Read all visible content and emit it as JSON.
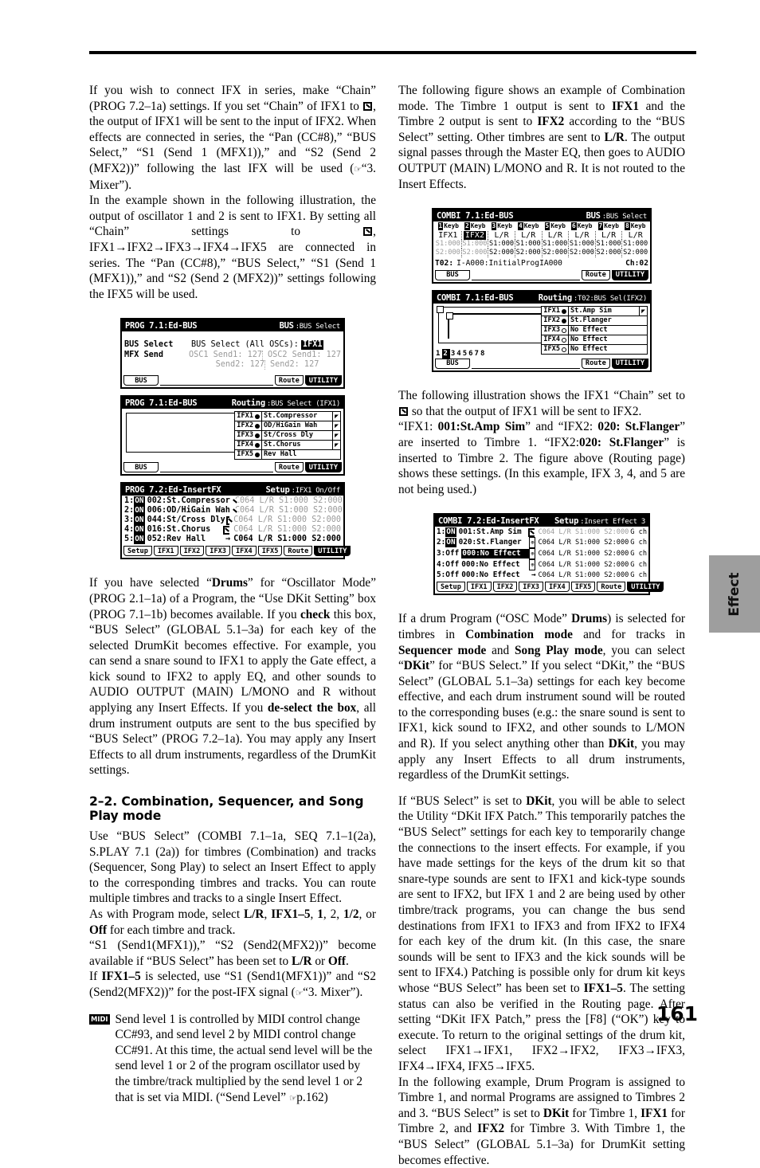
{
  "page": {
    "number": "161",
    "side_tab": "Effect"
  },
  "left_column": {
    "paragraphs": [
      "If you wish to connect IFX in series, make “Chain” (PROG 7.2–1a) settings. If you set “Chain” of IFX1 to ☑, the output of IFX1 will be sent to the input of IFX2. When effects are connected in series, the “Pan (CC#8),” “BUS Select,” “S1 (Send 1 (MFX1)),” and “S2 (Send 2 (MFX2))” following the last IFX will be used (☞“3. Mixer”).",
      "In the example shown in the following illustration, the output of oscillator 1 and 2 is sent to IFX1. By setting all “Chain” settings to ☑, IFX1→IFX2→IFX3→IFX4→IFX5 are connected in series. The “Pan (CC#8),” “BUS Select,” “S1 (Send 1 (MFX1)),” and “S2 (Send 2 (MFX2))” settings following the IFX5 will be used.",
      "If you have selected “Drums” for “Oscillator Mode” (PROG 2.1–1a) of a Program, the “Use DKit Setting” box (PROG 7.1–1b) becomes available. If you check this box, “BUS Select” (GLOBAL 5.1–3a) for each key of the selected DrumKit becomes effective. For example, you can send a snare sound to IFX1 to apply the Gate effect, a kick sound to IFX2 to apply EQ, and other sounds to AUDIO OUTPUT (MAIN) L/MONO and R without applying any Insert Effects. If you de-select the box, all drum instrument outputs are sent to the bus specified by “BUS Select” (PROG 7.2–1a). You may apply any Insert Effects to all drum instruments, regardless of the DrumKit settings."
    ],
    "heading": "2–2. Combination, Sequencer, and Song Play mode",
    "after_heading": [
      "Use “BUS Select” (COMBI 7.1–1a, SEQ 7.1–1(2a), S.PLAY 7.1 (2a)) for timbres (Combination) and tracks (Sequencer, Song Play) to select an Insert Effect to apply to the corresponding timbres and tracks. You can route multiple timbres and tracks to a single Insert Effect.",
      "As with Program mode, select L/R, IFX1–5, 1, 2, 1/2, or Off for each timbre and track.",
      "“S1 (Send1(MFX1)),” “S2 (Send2(MFX2))” become available if “BUS Select” has been set to L/R or Off.",
      "If IFX1–5 is selected, use “S1 (Send1(MFX1))” and “S2 (Send2(MFX2))” for the post-IFX signal (☞“3. Mixer”)."
    ],
    "midi_note": {
      "badge": "MIDI",
      "text": "Send level 1 is controlled by MIDI control change CC#93, and send level 2 by MIDI control change CC#91. At this time, the actual send level will be the send level 1 or 2 of the program oscillator used by the timbre/track multiplied by the send level 1 or 2 that is set via MIDI. (“Send Level” ☞p.162)"
    }
  },
  "right_column": {
    "paragraphs_top": [
      "The following figure shows an example of Combination mode. The Timbre 1 output is sent to IFX1 and the Timbre 2 output is sent to IFX2 according to the “BUS Select” setting. Other timbres are sent to L/R. The output signal passes through the Master EQ, then goes to AUDIO OUTPUT (MAIN) L/MONO and R. It is not routed to the Insert Effects."
    ],
    "paragraphs_mid": [
      "The following illustration shows the IFX1 “Chain” set to ☑ so that the output of IFX1 will be sent to IFX2.",
      "“IFX1: 001:St.Amp Sim” and “IFX2: 020: St.Flanger” are inserted to Timbre 1. “IFX2:020: St.Flanger” is inserted to Timbre 2. The figure above (Routing page) shows these settings. (In this example, IFX 3, 4, and 5 are not being used.)"
    ],
    "paragraphs_bottom": [
      "If a drum Program (“OSC Mode” Drums) is selected for timbres in Combination mode and for tracks in Sequencer mode and Song Play mode, you can select “DKit” for “BUS Select.” If you select “DKit,” the “BUS Select” (GLOBAL 5.1–3a) settings for each key become effective, and each drum instrument sound will be routed to the corresponding buses (e.g.: the snare sound is sent to IFX1, kick sound to IFX2, and other sounds to L/MON and R). If you select anything other than DKit, you may apply any Insert Effects to all drum instruments, regardless of the DrumKit settings.",
      "If “BUS Select” is set to DKit, you will be able to select the Utility “DKit IFX Patch.” This temporarily patches the “BUS Select” settings for each key to temporarily change the connections to the insert effects. For example, if you have made settings for the keys of the drum kit so that snare-type sounds are sent to IFX1 and kick-type sounds are sent to IFX2, but IFX 1 and 2 are being used by other timbre/track programs, you can change the bus send destinations from IFX1 to IFX3 and from IFX2 to IFX4 for each key of the drum kit. (In this case, the snare sounds will be sent to IFX3 and the kick sounds will be sent to IFX4.) Patching is possible only for drum kit keys whose “BUS Select” has been set to IFX1–5. The setting status can also be verified in the Routing page. After setting “DKit IFX Patch,” press the [F8] (“OK”) key to execute. To return to the original settings of the drum kit, select IFX1→IFX1, IFX2→IFX2, IFX3→IFX3, IFX4→IFX4, IFX5→IFX5.",
      "In the following example, Drum Program is assigned to Timbre 1, and normal Programs are assigned to Timbres 2 and 3. “BUS Select” is set to DKit for Timbre 1, IFX1 for Timbre 2, and IFX2 for Timbre 3. With Timbre 1, the “BUS Select” (GLOBAL 5.1–3a) for DrumKit setting becomes effective."
    ]
  },
  "lcd1": {
    "title_left": "PROG 7.1:Ed-BUS",
    "title_right_bold": "BUS",
    "title_right_small": ":BUS Select",
    "label1": "BUS Select",
    "label1_value_name": "BUS Select (All OSCs):",
    "label1_value": "IFX1",
    "label2": "MFX Send",
    "ghost_line1a": "OSC1 Send1: 127",
    "ghost_line1b": "OSC2 Send1: 127",
    "ghost_line2a": "Send2: 127",
    "ghost_line2b": "Send2: 127",
    "tab_left": "BUS",
    "tab_route": "Route",
    "tab_utility": "UTILITY"
  },
  "lcd2": {
    "title_left": "PROG 7.1:Ed-BUS",
    "title_right_bold": "Routing",
    "title_right_small": ":BUS Select (IFX1)",
    "fx_rows": [
      {
        "label": "IFX1",
        "state": "filled",
        "name": "St.Compressor",
        "chain": true
      },
      {
        "label": "IFX2",
        "state": "filled",
        "name": "OD/HiGain Wah",
        "chain": true
      },
      {
        "label": "IFX3",
        "state": "filled",
        "name": "St/Cross Dly",
        "chain": true
      },
      {
        "label": "IFX4",
        "state": "filled",
        "name": "St.Chorus",
        "chain": true
      },
      {
        "label": "IFX5",
        "state": "filled",
        "name": "Rev Hall",
        "chain": false
      }
    ],
    "tab_left": "BUS",
    "tab_route": "Route",
    "tab_utility": "UTILITY"
  },
  "lcd3": {
    "title_left": "PROG 7.2:Ed-InsertFX",
    "title_right_bold": "Setup",
    "title_right_small": ":IFX1 On/Off",
    "rows": [
      {
        "num": "1:",
        "on": "ON",
        "name": "002:St.Compressor",
        "chain": "chain",
        "tail": "C064 L/R S1:000 S2:000",
        "ghost": true
      },
      {
        "num": "2:",
        "on": "ON",
        "name": "006:OD/HiGain Wah",
        "chain": "chain",
        "tail": "C064 L/R S1:000 S2:000",
        "ghost": true
      },
      {
        "num": "3:",
        "on": "ON",
        "name": "044:St/Cross Dly",
        "chain": "chain",
        "tail": "C064 L/R S1:000 S2:000",
        "ghost": true
      },
      {
        "num": "4:",
        "on": "ON",
        "name": "016:St.Chorus",
        "chain": "chain",
        "tail": "C064 L/R S1:000 S2:000",
        "ghost": true
      },
      {
        "num": "5:",
        "on": "ON",
        "name": "052:Rev Hall",
        "chain": "arrow",
        "tail": "C064 L/R S1:000 S2:000",
        "ghost": false
      }
    ],
    "tabs": [
      "Setup",
      "IFX1",
      "IFX2",
      "IFX3",
      "IFX4",
      "IFX5",
      "Route",
      "UTILITY"
    ]
  },
  "lcd4": {
    "title_left": "COMBI 7.1:Ed-BUS",
    "title_right_bold": "BUS",
    "title_right_small": ":BUS Select",
    "keyb_headers": [
      "1",
      "2",
      "3",
      "4",
      "5",
      "6",
      "7",
      "8"
    ],
    "keyb_label": "Keyb",
    "bus_row": [
      "IFX1",
      "IFX2",
      "L/R",
      "L/R",
      "L/R",
      "L/R",
      "L/R",
      "L/R"
    ],
    "s1_row": [
      "S1:000",
      "S1:000",
      "S1:000",
      "S1:000",
      "S1:000",
      "S1:000",
      "S1:000",
      "S1:000"
    ],
    "s2_row": [
      "S2:000",
      "S2:000",
      "S2:000",
      "S2:000",
      "S2:000",
      "S2:000",
      "S2:000",
      "S2:000"
    ],
    "status_left": "T02:",
    "status_prog": "I-A000:InitialProgIA000",
    "status_right": "Ch:02",
    "tab_left": "BUS",
    "tab_route": "Route",
    "tab_utility": "UTILITY"
  },
  "lcd5": {
    "title_left": "COMBI 7.1:Ed-BUS",
    "title_right_bold": "Routing",
    "title_right_small": ":T02:BUS Sel(IFX2)",
    "timbre_numbers": [
      "1",
      "2",
      "3",
      "4",
      "5",
      "6",
      "7",
      "8"
    ],
    "selected_timbre": "2",
    "fx_rows": [
      {
        "label": "IFX1",
        "state": "filled",
        "name": "St.Amp Sim",
        "chain": true
      },
      {
        "label": "IFX2",
        "state": "filled",
        "name": "St.Flanger",
        "chain": false
      },
      {
        "label": "IFX3",
        "state": "open",
        "name": "No Effect",
        "chain": false
      },
      {
        "label": "IFX4",
        "state": "open",
        "name": "No Effect",
        "chain": false
      },
      {
        "label": "IFX5",
        "state": "open",
        "name": "No Effect",
        "chain": false
      }
    ],
    "tab_left": "BUS",
    "tab_route": "Route",
    "tab_utility": "UTILITY"
  },
  "lcd6": {
    "title_left": "COMBI 7.2:Ed-InsertFX",
    "title_right_bold": "Setup",
    "title_right_small": ":Insert Effect 3",
    "rows": [
      {
        "num": "1:",
        "on": "ON",
        "name": "001:St.Amp Sim",
        "chain": "chain",
        "tail": "C064 L/R S1:000 S2:000",
        "ghost": true,
        "ch": "G ch",
        "selected": false
      },
      {
        "num": "2:",
        "on": "ON",
        "name": "020:St.Flanger",
        "chain": "box",
        "tail": "C064 L/R S1:000 S2:000",
        "ghost": false,
        "ch": "G ch",
        "selected": false
      },
      {
        "num": "3:",
        "on": "Off",
        "name": "000:No Effect",
        "chain": "box",
        "tail": "C064 L/R S1:000 S2:000",
        "ghost": false,
        "ch": "G ch",
        "selected": true
      },
      {
        "num": "4:",
        "on": "Off",
        "name": "000:No Effect",
        "chain": "box",
        "tail": "C064 L/R S1:000 S2:000",
        "ghost": false,
        "ch": "G ch",
        "selected": false
      },
      {
        "num": "5:",
        "on": "Off",
        "name": "000:No Effect",
        "chain": "arrow",
        "tail": "C064 L/R S1:000 S2:000",
        "ghost": false,
        "ch": "G ch",
        "selected": false
      }
    ],
    "tabs": [
      "Setup",
      "IFX1",
      "IFX2",
      "IFX3",
      "IFX4",
      "IFX5",
      "Route",
      "UTILITY"
    ]
  }
}
